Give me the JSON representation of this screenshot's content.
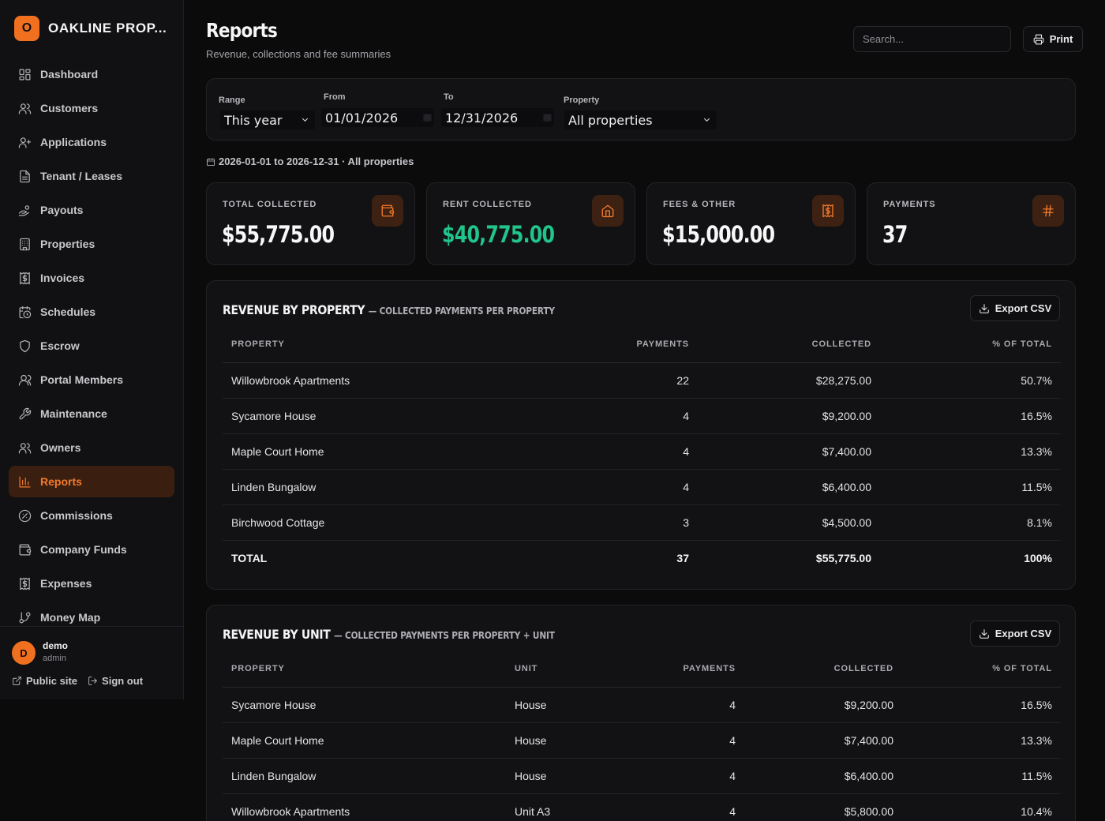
{
  "brand": {
    "logo_letter": "O",
    "name": "OAKLINE PROP..."
  },
  "nav": [
    {
      "label": "Dashboard",
      "icon": "dashboard-icon"
    },
    {
      "label": "Customers",
      "icon": "users-icon"
    },
    {
      "label": "Applications",
      "icon": "user-plus-icon"
    },
    {
      "label": "Tenant / Leases",
      "icon": "file-icon"
    },
    {
      "label": "Payouts",
      "icon": "hand-coins-icon"
    },
    {
      "label": "Properties",
      "icon": "building-icon"
    },
    {
      "label": "Invoices",
      "icon": "receipt-icon"
    },
    {
      "label": "Schedules",
      "icon": "calendar-clock-icon"
    },
    {
      "label": "Escrow",
      "icon": "shield-icon"
    },
    {
      "label": "Portal Members",
      "icon": "users-round-icon"
    },
    {
      "label": "Maintenance",
      "icon": "wrench-icon"
    },
    {
      "label": "Owners",
      "icon": "users-icon"
    },
    {
      "label": "Reports",
      "icon": "bar-chart-icon",
      "active": true
    },
    {
      "label": "Commissions",
      "icon": "percent-circle-icon"
    },
    {
      "label": "Company Funds",
      "icon": "wallet-icon"
    },
    {
      "label": "Expenses",
      "icon": "receipt-icon"
    },
    {
      "label": "Money Map",
      "icon": "git-branch-icon"
    }
  ],
  "user": {
    "avatar_letter": "D",
    "name": "demo",
    "role": "admin"
  },
  "footer_links": {
    "public_site": "Public site",
    "sign_out": "Sign out"
  },
  "header": {
    "title": "Reports",
    "subtitle": "Revenue, collections and fee summaries",
    "search_placeholder": "Search...",
    "print_label": "Print"
  },
  "filters": {
    "range_label": "Range",
    "range_value": "This year",
    "from_label": "From",
    "from_value": "01/01/2026",
    "to_label": "To",
    "to_value": "12/31/2026",
    "property_label": "Property",
    "property_value": "All properties"
  },
  "range_summary": "2026-01-01 to 2026-12-31 · All properties",
  "stats": [
    {
      "label": "TOTAL COLLECTED",
      "value": "$55,775.00",
      "icon": "wallet-icon"
    },
    {
      "label": "RENT COLLECTED",
      "value": "$40,775.00",
      "icon": "home-icon",
      "color": "#21c48a"
    },
    {
      "label": "FEES & OTHER",
      "value": "$15,000.00",
      "icon": "receipt-icon"
    },
    {
      "label": "PAYMENTS",
      "value": "37",
      "icon": "hash-icon"
    }
  ],
  "accent_color": "#f0701f",
  "revenue_by_property": {
    "title": "REVENUE BY PROPERTY",
    "subtitle": "— COLLECTED PAYMENTS PER PROPERTY",
    "export_label": "Export CSV",
    "columns": [
      "PROPERTY",
      "PAYMENTS",
      "COLLECTED",
      "% OF TOTAL"
    ],
    "rows": [
      [
        "Willowbrook Apartments",
        "22",
        "$28,275.00",
        "50.7%"
      ],
      [
        "Sycamore House",
        "4",
        "$9,200.00",
        "16.5%"
      ],
      [
        "Maple Court Home",
        "4",
        "$7,400.00",
        "13.3%"
      ],
      [
        "Linden Bungalow",
        "4",
        "$6,400.00",
        "11.5%"
      ],
      [
        "Birchwood Cottage",
        "3",
        "$4,500.00",
        "8.1%"
      ]
    ],
    "total": [
      "TOTAL",
      "37",
      "$55,775.00",
      "100%"
    ]
  },
  "revenue_by_unit": {
    "title": "REVENUE BY UNIT",
    "subtitle": "— COLLECTED PAYMENTS PER PROPERTY + UNIT",
    "export_label": "Export CSV",
    "columns": [
      "PROPERTY",
      "UNIT",
      "PAYMENTS",
      "COLLECTED",
      "% OF TOTAL"
    ],
    "rows": [
      [
        "Sycamore House",
        "House",
        "4",
        "$9,200.00",
        "16.5%"
      ],
      [
        "Maple Court Home",
        "House",
        "4",
        "$7,400.00",
        "13.3%"
      ],
      [
        "Linden Bungalow",
        "House",
        "4",
        "$6,400.00",
        "11.5%"
      ],
      [
        "Willowbrook Apartments",
        "Unit A3",
        "4",
        "$5,800.00",
        "10.4%"
      ]
    ]
  }
}
